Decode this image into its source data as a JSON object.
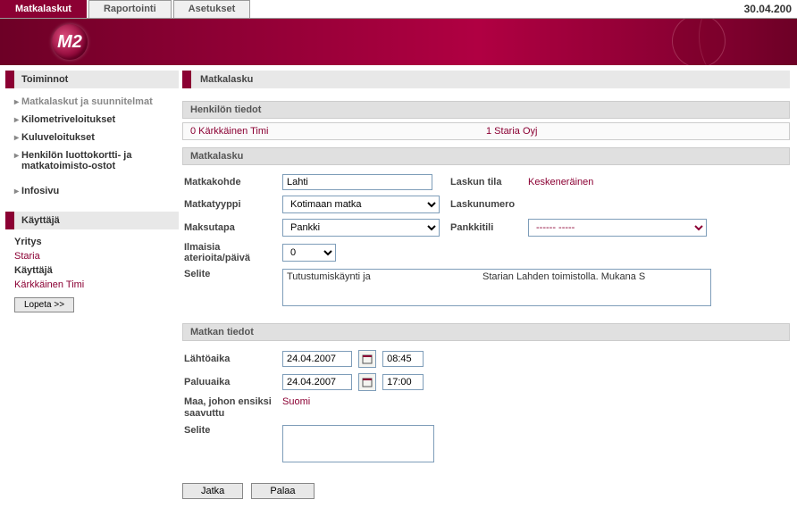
{
  "date": "30.04.200",
  "tabs": {
    "t0": "Matkalaskut",
    "t1": "Raportointi",
    "t2": "Asetukset"
  },
  "logo": "M2",
  "sidebar": {
    "toiminnot": "Toiminnot",
    "items": [
      "Matkalaskut ja suunnitelmat",
      "Kilometriveloitukset",
      "Kuluveloitukset",
      "Henkilön luottokortti- ja matkatoimisto-ostot",
      "Infosivu"
    ],
    "kayttaja": "Käyttäjä",
    "user": {
      "yritys_label": "Yritys",
      "yritys_value": "Staria",
      "kayttaja_label": "Käyttäjä",
      "kayttaja_value": "Kärkkäinen Timi",
      "logout": "Lopeta >>"
    }
  },
  "main": {
    "title": "Matkalasku",
    "henkilo": {
      "title": "Henkilön tiedot",
      "left": "0 Kärkkäinen Timi",
      "right": "1 Staria Oyj"
    },
    "matkalasku": {
      "title": "Matkalasku",
      "matkakohde_label": "Matkakohde",
      "matkakohde_value": "Lahti",
      "laskun_tila_label": "Laskun tila",
      "laskun_tila_value": "Keskeneräinen",
      "matkatyyppi_label": "Matkatyyppi",
      "matkatyyppi_value": "Kotimaan matka",
      "laskunumero_label": "Laskunumero",
      "laskunumero_value": "",
      "maksutapa_label": "Maksutapa",
      "maksutapa_value": "Pankki",
      "pankkitili_label": "Pankkitili",
      "pankkitili_value": "------ -----",
      "ilmaisia_label": "Ilmaisia aterioita/päivä",
      "ilmaisia_value": "0",
      "selite_label": "Selite",
      "selite_value": "Tutustumiskäynti ja                                         Starian Lahden toimistolla. Mukana S"
    },
    "matkan": {
      "title": "Matkan tiedot",
      "lahto_label": "Lähtöaika",
      "lahto_date": "24.04.2007",
      "lahto_time": "08:45",
      "paluu_label": "Paluuaika",
      "paluu_date": "24.04.2007",
      "paluu_time": "17:00",
      "maa_label": "Maa, johon ensiksi saavuttu",
      "maa_value": "Suomi",
      "selite2_label": "Selite",
      "selite2_value": ""
    },
    "buttons": {
      "jatka": "Jatka",
      "palaa": "Palaa"
    }
  }
}
